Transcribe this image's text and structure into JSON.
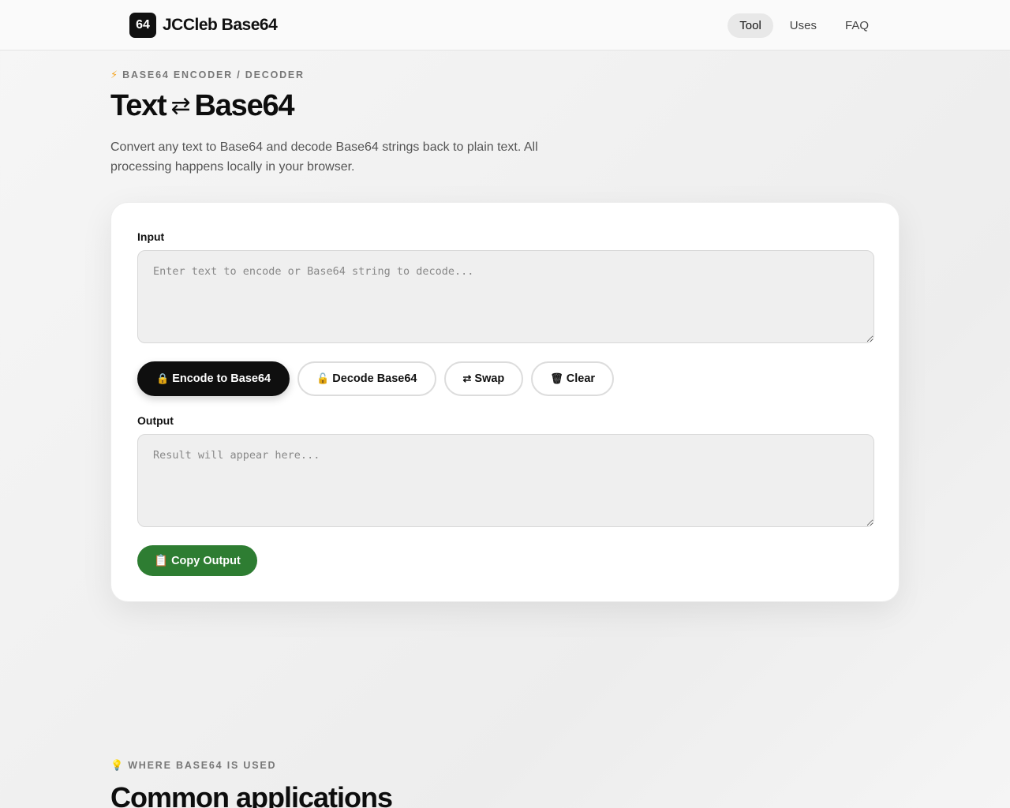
{
  "header": {
    "logo_badge": "64",
    "brand_name": "JCCleb Base64",
    "nav": [
      {
        "label": "Tool",
        "active": true
      },
      {
        "label": "Uses",
        "active": false
      },
      {
        "label": "FAQ",
        "active": false
      }
    ]
  },
  "hero": {
    "eyebrow_icon": "⚡",
    "eyebrow": "BASE64 ENCODER / DECODER",
    "title_left": "Text",
    "title_arrow": "⇄",
    "title_right": "Base64",
    "description": "Convert any text to Base64 and decode Base64 strings back to plain text. All processing happens locally in your browser."
  },
  "tool": {
    "input_label": "Input",
    "input_placeholder": "Enter text to encode or Base64 string to decode...",
    "input_value": "",
    "buttons": {
      "encode_icon": "🔒",
      "encode": "Encode to Base64",
      "decode_icon": "🔓",
      "decode": "Decode Base64",
      "swap_icon": "⇄",
      "swap": "Swap",
      "clear_icon": "🗑",
      "clear": "Clear"
    },
    "output_label": "Output",
    "output_placeholder": "Result will appear here...",
    "output_value": "",
    "copy_icon": "📋",
    "copy": "Copy Output"
  },
  "uses_section": {
    "eyebrow_icon": "💡",
    "eyebrow": "WHERE BASE64 IS USED",
    "title": "Common applications"
  },
  "colors": {
    "primary": "#0f0f0f",
    "copy_button": "#2e7d32",
    "accent_bolt": "#f5a623"
  }
}
